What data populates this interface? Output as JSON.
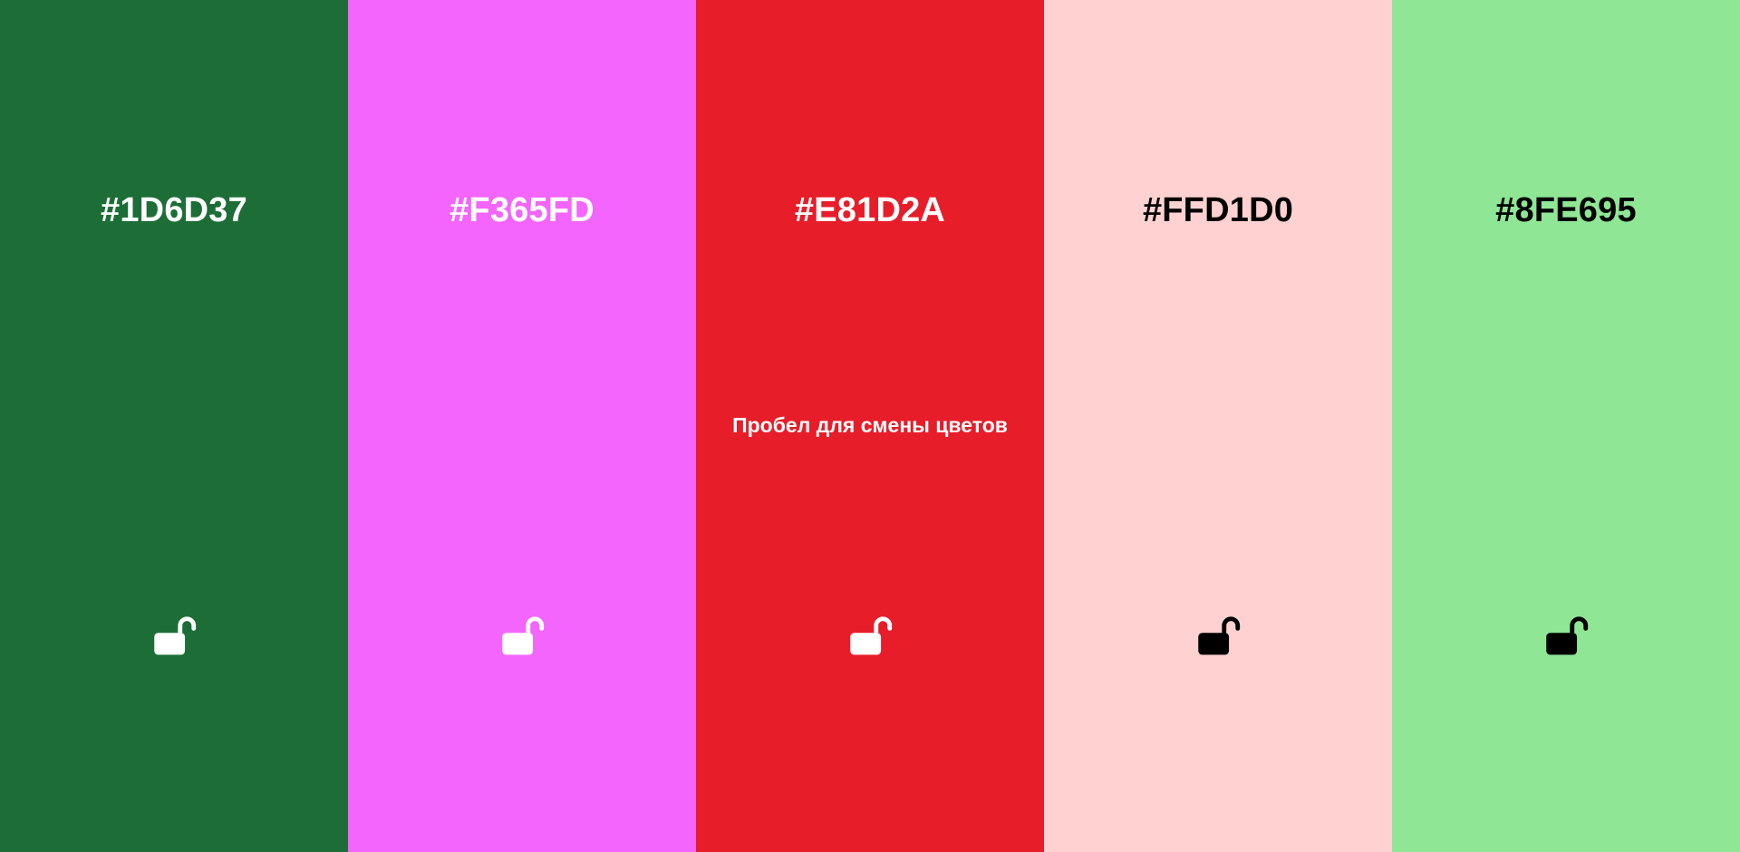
{
  "hint": "Пробел для смены цветов",
  "columns": [
    {
      "hex": "#1D6D37",
      "background": "#1D6D37",
      "text_color": "#FFFFFF",
      "lock_icon": "lock-open-icon",
      "locked": false
    },
    {
      "hex": "#F365FD",
      "background": "#F365FD",
      "text_color": "#FFFFFF",
      "lock_icon": "lock-open-icon",
      "locked": false
    },
    {
      "hex": "#E81D2A",
      "background": "#E81D2A",
      "text_color": "#FFFFFF",
      "lock_icon": "lock-open-icon",
      "locked": false
    },
    {
      "hex": "#FFD1D0",
      "background": "#FFD1D0",
      "text_color": "#000000",
      "lock_icon": "lock-open-icon",
      "locked": false
    },
    {
      "hex": "#8FE695",
      "background": "#8FE695",
      "text_color": "#000000",
      "lock_icon": "lock-open-icon",
      "locked": false
    }
  ]
}
